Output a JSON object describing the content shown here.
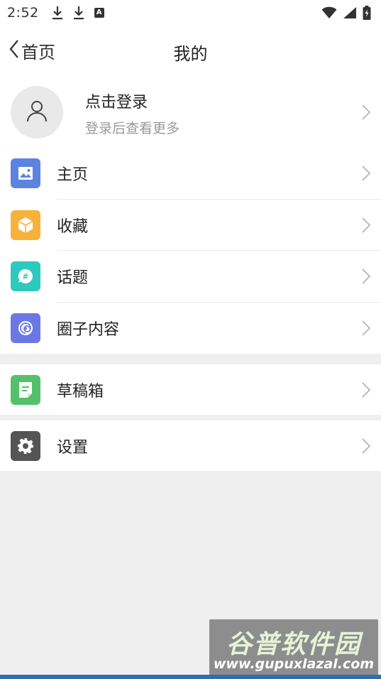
{
  "status_bar": {
    "time": "2:52",
    "icons_left": [
      "download-icon",
      "download-icon",
      "a-notification-icon"
    ],
    "icons_right": [
      "wifi-icon",
      "signal-icon",
      "battery-icon"
    ]
  },
  "header": {
    "back_label": "首页",
    "title": "我的"
  },
  "login": {
    "title": "点击登录",
    "subtitle": "登录后查看更多"
  },
  "menu_group_1": [
    {
      "label": "主页",
      "icon": "image-icon",
      "color": "#5b84e0"
    },
    {
      "label": "收藏",
      "icon": "cube-icon",
      "color": "#f7b23b"
    },
    {
      "label": "话题",
      "icon": "topic-bubble-icon",
      "color": "#2ec9bd"
    },
    {
      "label": "圈子内容",
      "icon": "circle-swirl-icon",
      "color": "#6b78e3"
    }
  ],
  "menu_group_2": [
    {
      "label": "草稿箱",
      "icon": "draft-note-icon",
      "color": "#55c06a"
    }
  ],
  "menu_group_3": [
    {
      "label": "设置",
      "icon": "gear-icon",
      "color": "#555555"
    }
  ],
  "watermark": {
    "name": "谷普软件园",
    "url": "www.gupuxlazal.com"
  }
}
